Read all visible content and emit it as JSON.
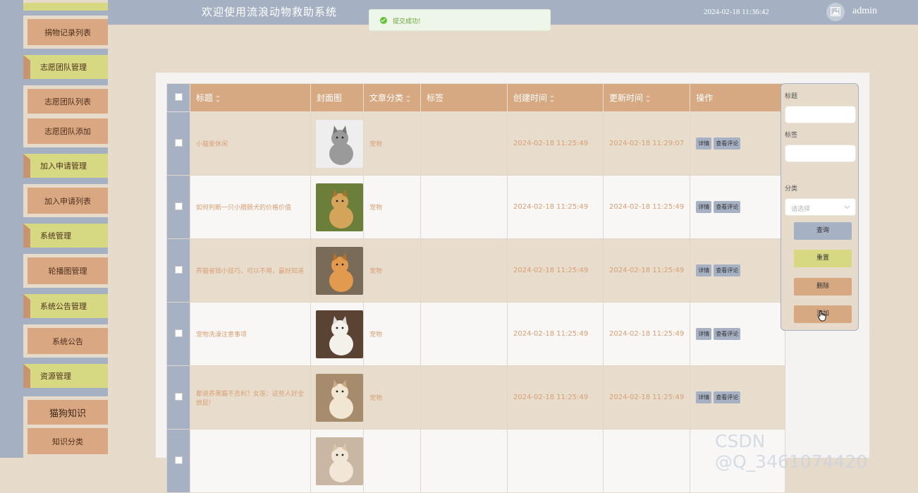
{
  "header": {
    "title": "欢迎使用流浪动物救助系统",
    "datetime": "2024-02-18 11:36:42",
    "username": "admin"
  },
  "toast": {
    "message": "提交成功!"
  },
  "sidebar": {
    "items": [
      {
        "label": "捐物记录列表",
        "type": "item"
      },
      {
        "label": "志愿团队管理",
        "type": "group"
      },
      {
        "label": "志愿团队列表",
        "type": "item"
      },
      {
        "label": "志愿团队添加",
        "type": "item"
      },
      {
        "label": "加入申请管理",
        "type": "group"
      },
      {
        "label": "加入申请列表",
        "type": "item"
      },
      {
        "label": "系统管理",
        "type": "group"
      },
      {
        "label": "轮播图管理",
        "type": "item"
      },
      {
        "label": "系统公告管理",
        "type": "group"
      },
      {
        "label": "系统公告",
        "type": "item"
      },
      {
        "label": "资源管理",
        "type": "group"
      },
      {
        "label": "猫狗知识",
        "type": "item"
      },
      {
        "label": "知识分类",
        "type": "item"
      }
    ]
  },
  "table": {
    "headers": {
      "title": "标题",
      "cover": "封面图",
      "category": "文章分类",
      "tags": "标签",
      "created": "创建时间",
      "updated": "更新时间",
      "actions": "操作"
    },
    "action_labels": {
      "detail": "详情",
      "comments": "查看评论"
    },
    "rows": [
      {
        "title": "小猫爱休闲",
        "category": "宠物",
        "tags": "",
        "created": "2024-02-18 11:25:49",
        "updated": "2024-02-18 11:29:07"
      },
      {
        "title": "如何判断一只小腊肠犬的价格价值",
        "category": "宠物",
        "tags": "",
        "created": "2024-02-18 11:25:49",
        "updated": "2024-02-18 11:25:49"
      },
      {
        "title": "养猫省钱小技巧，可以不用，最好知道",
        "category": "宠物",
        "tags": "",
        "created": "2024-02-18 11:25:49",
        "updated": "2024-02-18 11:25:49"
      },
      {
        "title": "宠物洗澡注意事项",
        "category": "宠物",
        "tags": "",
        "created": "2024-02-18 11:25:49",
        "updated": "2024-02-18 11:25:49"
      },
      {
        "title": "都说养黑猫不吉利？女巫：这些人好全放屁!",
        "category": "宠物",
        "tags": "",
        "created": "2024-02-18 11:25:49",
        "updated": "2024-02-18 11:25:49"
      },
      {
        "title": "",
        "category": "",
        "tags": "",
        "created": "",
        "updated": ""
      }
    ]
  },
  "search": {
    "title_label": "标题",
    "tag_label": "标签",
    "category_label": "分类",
    "category_placeholder": "请选择",
    "query_button": "查询",
    "reset_button": "重置",
    "delete_button": "删除",
    "add_button": "添加"
  },
  "watermark": "CSDN @Q_3461074420",
  "colors": {
    "background": "#e6dbcb",
    "header": "#a5b1c3",
    "table_header": "#d6a982",
    "group_item": "#d6d982",
    "sub_item": "#d9a882"
  }
}
